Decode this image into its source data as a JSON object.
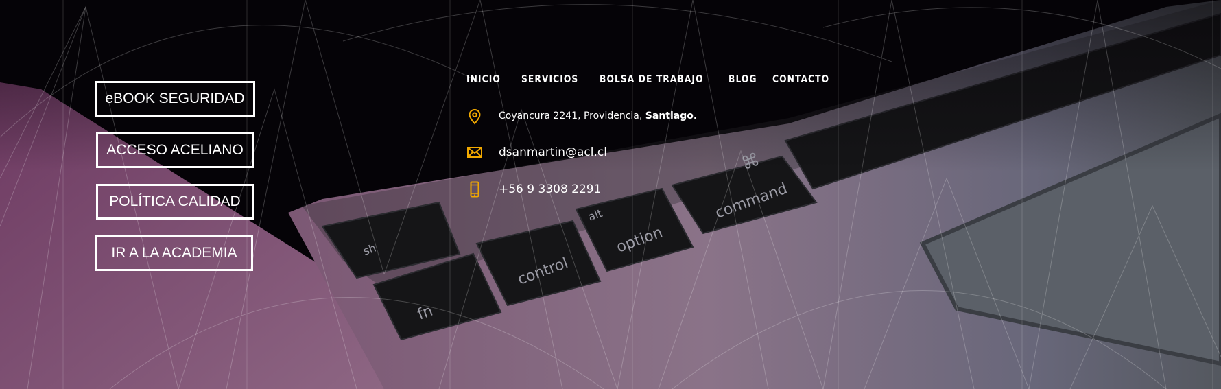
{
  "buttons": [
    {
      "label": "eBOOK SEGURIDAD"
    },
    {
      "label": "ACCESO ACELIANO"
    },
    {
      "label": "POLÍTICA CALIDAD"
    },
    {
      "label": "IR A LA ACADEMIA"
    }
  ],
  "nav": [
    {
      "label": "INICIO"
    },
    {
      "label": "SERVICIOS"
    },
    {
      "label": "BOLSA DE TRABAJO"
    },
    {
      "label": "BLOG"
    },
    {
      "label": "CONTACTO"
    }
  ],
  "contact": {
    "address_prefix": "Coyancura 2241, Providencia, ",
    "address_city": "Santiago.",
    "email": "dsanmartin@acl.cl",
    "phone": "+56 9 3308 2291"
  },
  "keys": {
    "fn": "fn",
    "control": "control",
    "alt": "alt",
    "option": "option",
    "command": "command",
    "command_symbol": "⌘",
    "shift": "sh"
  },
  "icons": {
    "address": "map-pin-icon",
    "email": "envelope-icon",
    "phone": "mobile-phone-icon"
  },
  "colors": {
    "accent": "#f2a900",
    "background": "#050307",
    "text": "#ffffff"
  }
}
